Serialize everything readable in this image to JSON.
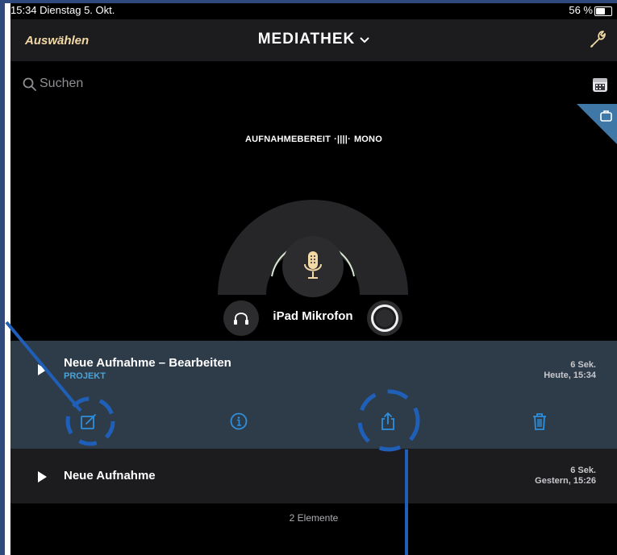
{
  "status_bar": {
    "time_date": "15:34  Dienstag 5. Okt.",
    "battery": "56 %"
  },
  "nav": {
    "left_button": "Auswählen",
    "title": "MEDIATHEK",
    "title_chevron": "⌄",
    "right_icon": "wrench-icon"
  },
  "search": {
    "placeholder": "Suchen"
  },
  "recorder": {
    "status_left": "AUFNAHMEBEREIT",
    "status_wave": "·||||·",
    "status_right": "MONO",
    "input_label": "iPad Mikrofon"
  },
  "recordings": [
    {
      "title": "Neue Aufnahme – Bearbeiten",
      "subtitle": "PROJEKT",
      "duration": "6 Sek.",
      "date": "Heute, 15:34",
      "expanded": true
    },
    {
      "title": "Neue Aufnahme",
      "subtitle": "",
      "duration": "6 Sek.",
      "date": "Gestern, 15:26",
      "expanded": false
    }
  ],
  "actions": [
    "edit-icon",
    "info-icon",
    "share-icon",
    "trash-icon"
  ],
  "footer": {
    "count_label": "2 Elemente"
  },
  "colors": {
    "accent": "#f2d9a6",
    "action_blue": "#2f8fdc",
    "selected_row": "#2e3c4a",
    "annotation": "#1f5fb8"
  }
}
